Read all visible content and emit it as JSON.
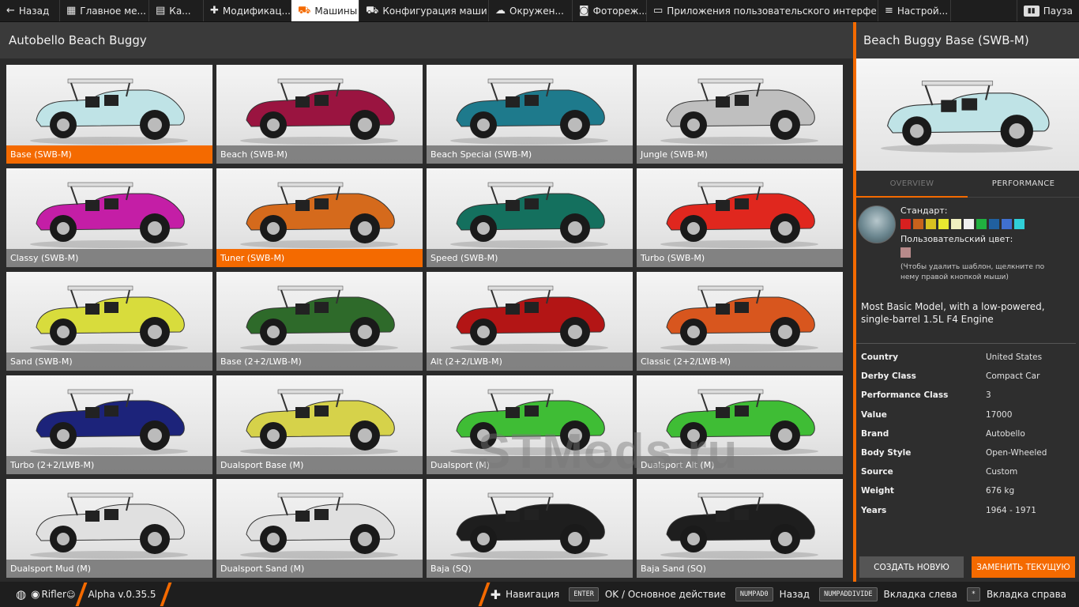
{
  "topbar": {
    "back_label": "Назад",
    "tabs": [
      {
        "label": "Главное ме...",
        "icon": "grid-icon"
      },
      {
        "label": "Ка...",
        "icon": "map-icon"
      },
      {
        "label": "Модификац...",
        "icon": "puzzle-icon"
      },
      {
        "label": "Машины",
        "icon": "car-icon",
        "active": true
      },
      {
        "label": "Конфигурация маши...",
        "icon": "car-config-icon"
      },
      {
        "label": "Окружен...",
        "icon": "weather-icon"
      },
      {
        "label": "Фотореж...",
        "icon": "camera-icon"
      },
      {
        "label": "Приложения пользовательского интерфе...",
        "icon": "window-icon"
      },
      {
        "label": "Настрой...",
        "icon": "sliders-icon"
      }
    ],
    "pause_label": "Пауза"
  },
  "left_header": {
    "title": "Autobello Beach Buggy"
  },
  "configs": [
    {
      "label": "Base (SWB-M)",
      "color": "#bfe3e6",
      "selected": true
    },
    {
      "label": "Beach (SWB-M)",
      "color": "#9a1440"
    },
    {
      "label": "Beach Special (SWB-M)",
      "color": "#1e7a8c"
    },
    {
      "label": "Jungle (SWB-M)",
      "color": "#bfbfbf"
    },
    {
      "label": "Classy (SWB-M)",
      "color": "#c41ea6"
    },
    {
      "label": "Tuner (SWB-M)",
      "color": "#d56a1c",
      "selected": true
    },
    {
      "label": "Speed (SWB-M)",
      "color": "#14705e"
    },
    {
      "label": "Turbo (SWB-M)",
      "color": "#e0271e"
    },
    {
      "label": "Sand (SWB-M)",
      "color": "#d8dc3c"
    },
    {
      "label": "Base (2+2/LWB-M)",
      "color": "#2e6a2a"
    },
    {
      "label": "Alt (2+2/LWB-M)",
      "color": "#b31515"
    },
    {
      "label": "Classic (2+2/LWB-M)",
      "color": "#d8561e"
    },
    {
      "label": "Turbo (2+2/LWB-M)",
      "color": "#1c237a"
    },
    {
      "label": "Dualsport Base (M)",
      "color": "#d6d24a"
    },
    {
      "label": "Dualsport (M)",
      "color": "#3fbd35"
    },
    {
      "label": "Dualsport Alt (M)",
      "color": "#3fbd35"
    },
    {
      "label": "Dualsport Mud (M)",
      "color": "#e0e0e0"
    },
    {
      "label": "Dualsport Sand (M)",
      "color": "#e0e0e0"
    },
    {
      "label": "Baja (SQ)",
      "color": "#1e1e1e"
    },
    {
      "label": "Baja Sand (SQ)",
      "color": "#1e1e1e"
    }
  ],
  "detail": {
    "title": "Beach Buggy Base (SWB-M)",
    "preview_color": "#bfe3e6",
    "tabs": {
      "overview": "OVERVIEW",
      "performance": "PERFORMANCE"
    },
    "paint": {
      "standard_label": "Стандарт:",
      "swatches": [
        "#d82020",
        "#c8621c",
        "#d8c020",
        "#e8e830",
        "#f0f0c0",
        "#f0f0f0",
        "#20b040",
        "#2060a0",
        "#4070d0",
        "#30d0d8"
      ],
      "custom_label": "Пользовательский цвет:",
      "custom_color": "#b78a8a",
      "hint": "(Чтобы удалить шаблон, щелкните по нему правой кнопкой мыши)"
    },
    "description": "Most Basic Model, with a low-powered, single-barrel 1.5L F4 Engine",
    "properties": [
      {
        "key": "Country",
        "value": "United States"
      },
      {
        "key": "Derby Class",
        "value": "Compact Car"
      },
      {
        "key": "Performance Class",
        "value": "3"
      },
      {
        "key": "Value",
        "value": "17000"
      },
      {
        "key": "Brand",
        "value": "Autobello"
      },
      {
        "key": "Body Style",
        "value": "Open-Wheeled"
      },
      {
        "key": "Source",
        "value": "Custom"
      },
      {
        "key": "Weight",
        "value": "676 kg"
      },
      {
        "key": "Years",
        "value": "1964 - 1971"
      }
    ],
    "buttons": {
      "create": "СОЗДАТЬ НОВУЮ",
      "replace": "ЗАМЕНИТЬ ТЕКУЩУЮ"
    }
  },
  "bottombar": {
    "user": "Rifler",
    "version": "Alpha v.0.35.5",
    "navigation_label": "Навигация",
    "hints": [
      {
        "key": "ENTER",
        "label": "OK / Основное действие"
      },
      {
        "key": "NUMPAD0",
        "label": "Назад"
      },
      {
        "key": "NUMPADDIVIDE",
        "label": "Вкладка слева"
      },
      {
        "key": "*",
        "label": "Вкладка справа"
      }
    ]
  },
  "watermark": "STMods.ru"
}
